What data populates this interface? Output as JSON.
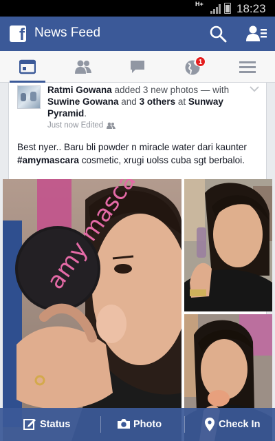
{
  "status_bar": {
    "network": "H+",
    "time": "18:23"
  },
  "title_bar": {
    "title": "News Feed"
  },
  "tabs": [
    {
      "icon": "news-feed-icon",
      "active": true
    },
    {
      "icon": "friend-requests-icon",
      "active": false
    },
    {
      "icon": "messages-icon",
      "active": false
    },
    {
      "icon": "notifications-globe-icon",
      "active": false,
      "badge": "1"
    },
    {
      "icon": "more-menu-icon",
      "active": false
    }
  ],
  "post": {
    "author": "Ratmi Gowana",
    "action_text": " added 3 new photos — with ",
    "tagged": "Suwine Gowana",
    "and_text": " and ",
    "others": "3 others",
    "at_text": " at ",
    "place": "Sunway Pyramid",
    "period": ".",
    "time": "Just now",
    "edited": "Edited",
    "text_line1": "Best nyer.. Baru bli powder n miracle water dari kaunter",
    "hashtag": "#amymascara",
    "text_line2": "  cosmetic, xrugi uolss cuba sgt berbaloi.",
    "mirror_logo_text": "amy mascara"
  },
  "actions": {
    "status": "Status",
    "photo": "Photo",
    "check_in": "Check In"
  },
  "colors": {
    "brand": "#3b5998",
    "badge": "#e41e1e"
  }
}
